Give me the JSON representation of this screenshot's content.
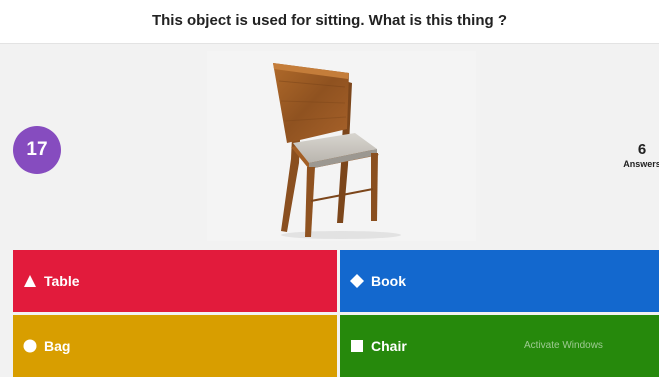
{
  "question": {
    "text": "This object is used for sitting. What is this thing ?"
  },
  "timer": {
    "value": "17"
  },
  "answers_count": {
    "number": "6",
    "label": "Answers"
  },
  "media": {
    "icon": "chair-photo"
  },
  "answers": [
    {
      "label": "Table",
      "shape": "triangle",
      "color": "#e21b3c"
    },
    {
      "label": "Book",
      "shape": "diamond",
      "color": "#1368ce"
    },
    {
      "label": "Bag",
      "shape": "circle",
      "color": "#d89e00"
    },
    {
      "label": "Chair",
      "shape": "square",
      "color": "#26890c"
    }
  ],
  "colors": {
    "timer": "#864cbf",
    "background": "#f2f2f2"
  },
  "watermark": {
    "text": "Activate Windows"
  }
}
